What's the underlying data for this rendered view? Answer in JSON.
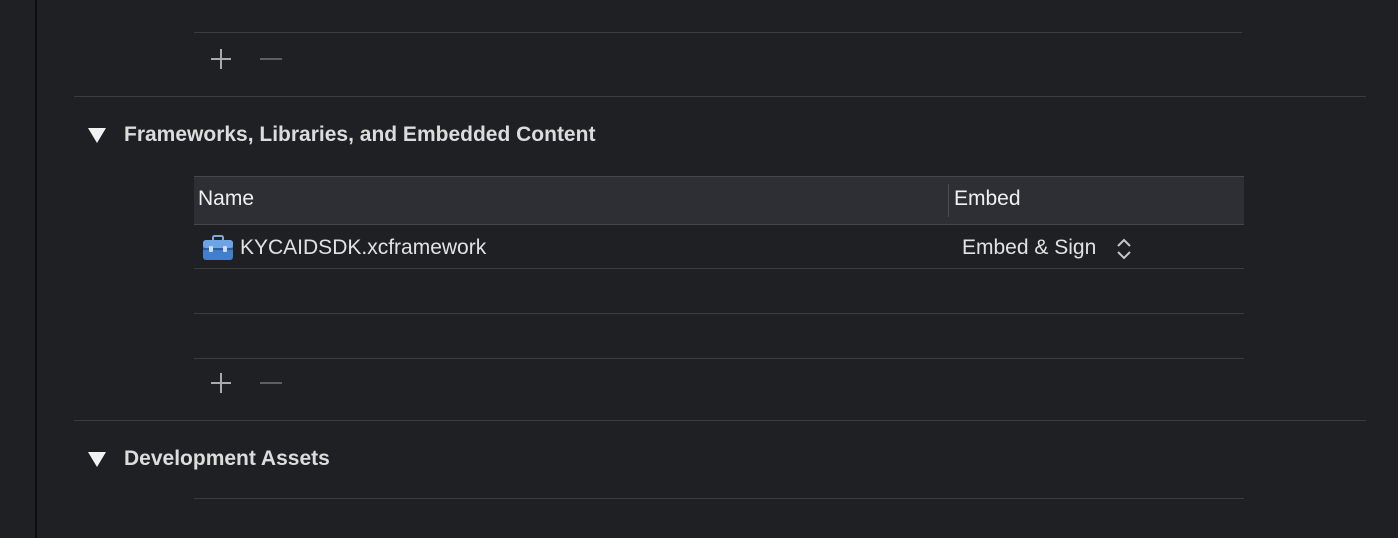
{
  "top_section": {
    "add_icon": "plus-icon",
    "remove_icon": "minus-icon"
  },
  "frameworks": {
    "title": "Frameworks, Libraries, and Embedded Content",
    "disclosure_icon": "disclosure-triangle-down-icon",
    "columns": {
      "name": "Name",
      "embed": "Embed"
    },
    "rows": [
      {
        "icon": "toolbox-icon",
        "name": "KYCAIDSDK.xcframework",
        "embed": "Embed & Sign",
        "embed_control_icon": "up-down-chevron-icon"
      }
    ],
    "add_icon": "plus-icon",
    "remove_icon": "minus-icon"
  },
  "development_assets": {
    "title": "Development Assets",
    "disclosure_icon": "disclosure-triangle-down-icon"
  },
  "colors": {
    "background": "#1f2024",
    "header_bg": "#2d2f35",
    "divider": "#3b3c41",
    "text": "#dfdfe0"
  }
}
